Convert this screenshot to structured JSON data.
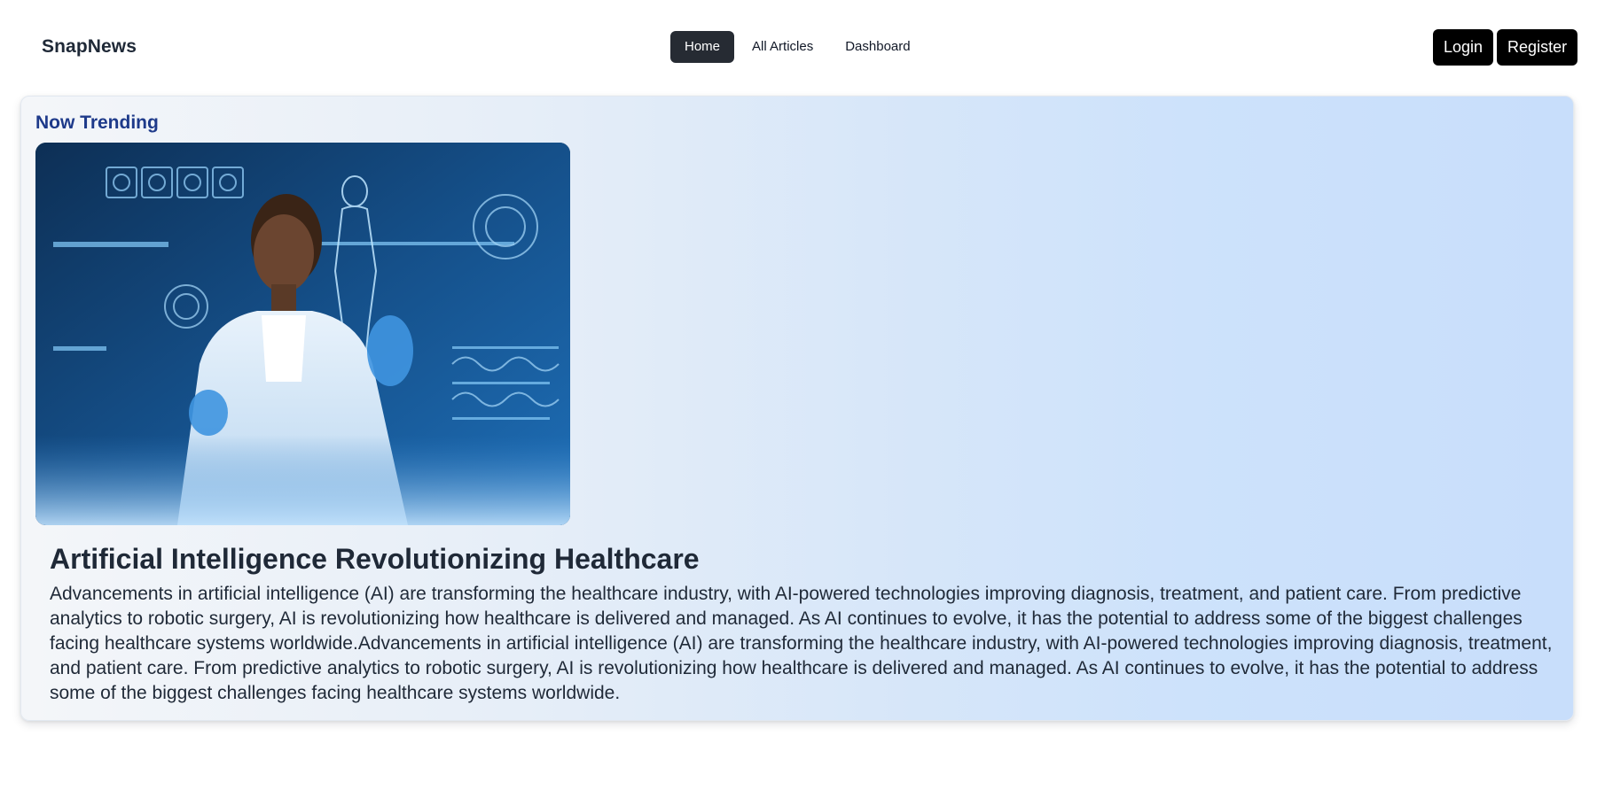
{
  "navbar": {
    "brand": "SnapNews",
    "links": [
      {
        "label": "Home",
        "active": true
      },
      {
        "label": "All Articles",
        "active": false
      },
      {
        "label": "Dashboard",
        "active": false
      }
    ],
    "login_label": "Login",
    "register_label": "Register"
  },
  "trending": {
    "section_title": "Now Trending",
    "image_icon": "ai-healthcare-photo",
    "article_title": "Artificial Intelligence Revolutionizing Healthcare",
    "article_body": "Advancements in artificial intelligence (AI) are transforming the healthcare industry, with AI-powered technologies improving diagnosis, treatment, and patient care. From predictive analytics to robotic surgery, AI is revolutionizing how healthcare is delivered and managed. As AI continues to evolve, it has the potential to address some of the biggest challenges facing healthcare systems worldwide.Advancements in artificial intelligence (AI) are transforming the healthcare industry, with AI-powered technologies improving diagnosis, treatment, and patient care. From predictive analytics to robotic surgery, AI is revolutionizing how healthcare is delivered and managed. As AI continues to evolve, it has the potential to address some of the biggest challenges facing healthcare systems worldwide."
  },
  "colors": {
    "brand_text": "#1f2937",
    "active_nav_bg": "#262b33",
    "auth_button_bg": "#000000",
    "section_title": "#1e3a8a",
    "card_gradient_start": "#f4f6f9",
    "card_gradient_end": "#c8defb"
  }
}
